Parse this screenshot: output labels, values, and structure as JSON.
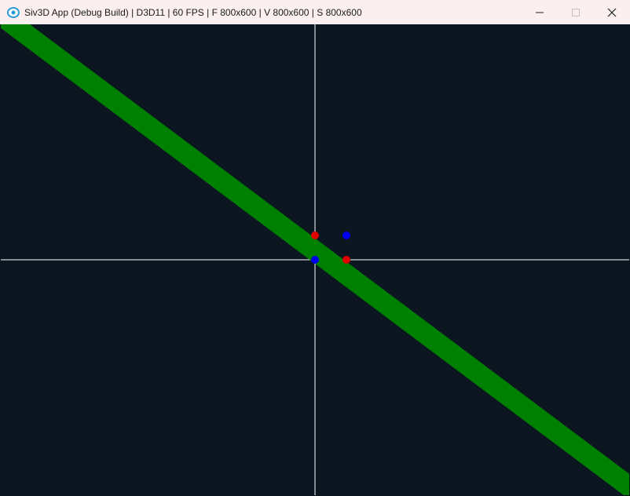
{
  "window": {
    "title": "Siv3D App (Debug Build) | D3D11 | 60 FPS | F 800x600 | V 800x600 | S 800x600",
    "icon": "siv3d-app-icon",
    "controls": {
      "minimize_icon": "minimize-icon",
      "maximize_icon": "maximize-icon",
      "close_icon": "close-icon"
    }
  },
  "scene": {
    "background_color": "#0b1621",
    "axis_color": "#ffffff",
    "line_color": "#008000",
    "red_point_color": "#e00000",
    "blue_point_color": "#0000ee"
  }
}
